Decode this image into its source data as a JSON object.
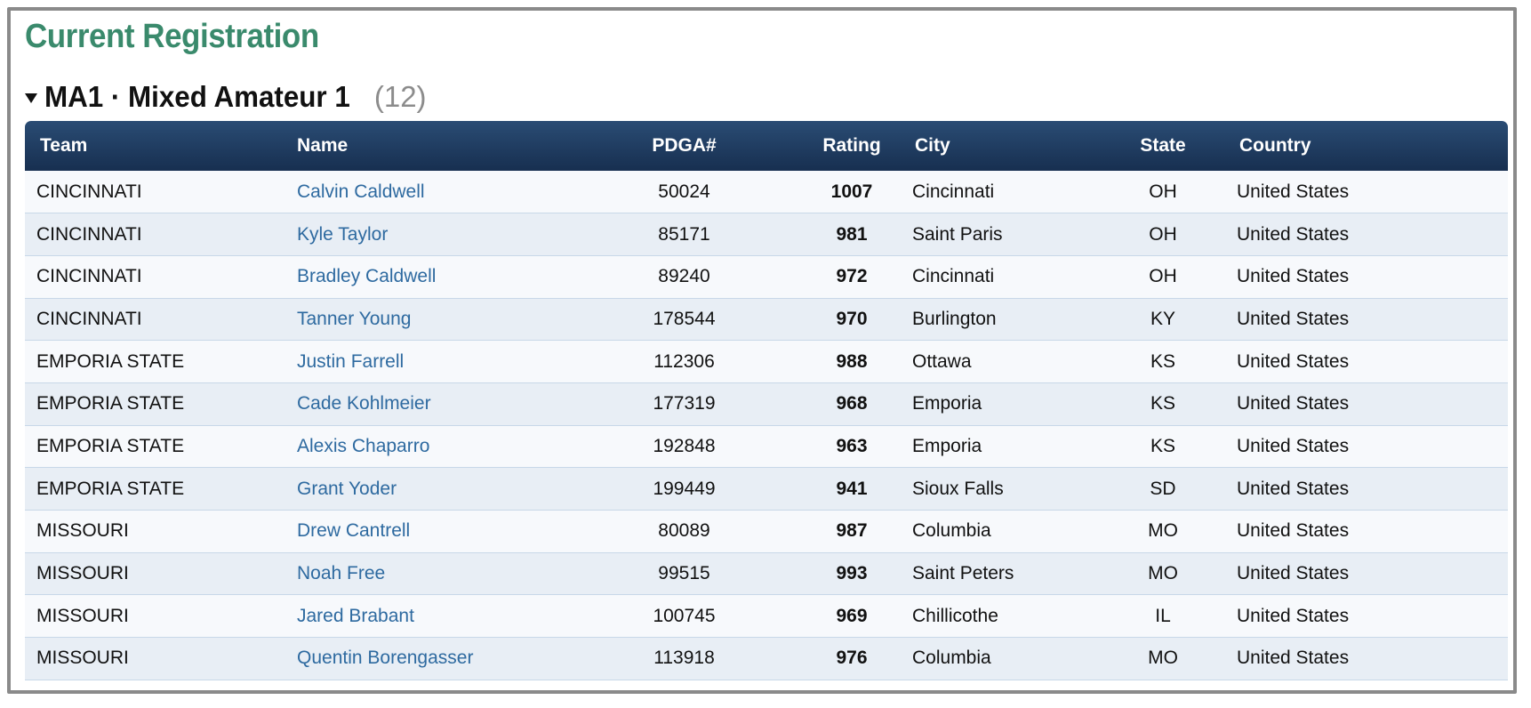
{
  "page_title": "Current Registration",
  "division": {
    "title": "MA1 · Mixed Amateur 1",
    "count": "(12)",
    "toggle_icon": "triangle-down-icon"
  },
  "table": {
    "headers": {
      "team": "Team",
      "name": "Name",
      "pdga": "PDGA#",
      "rating": "Rating",
      "city": "City",
      "state": "State",
      "country": "Country"
    },
    "rows": [
      {
        "team": "CINCINNATI",
        "name": "Calvin Caldwell",
        "pdga": "50024",
        "rating": "1007",
        "city": "Cincinnati",
        "state": "OH",
        "country": "United States"
      },
      {
        "team": "CINCINNATI",
        "name": "Kyle Taylor",
        "pdga": "85171",
        "rating": "981",
        "city": "Saint Paris",
        "state": "OH",
        "country": "United States"
      },
      {
        "team": "CINCINNATI",
        "name": "Bradley Caldwell",
        "pdga": "89240",
        "rating": "972",
        "city": "Cincinnati",
        "state": "OH",
        "country": "United States"
      },
      {
        "team": "CINCINNATI",
        "name": "Tanner Young",
        "pdga": "178544",
        "rating": "970",
        "city": "Burlington",
        "state": "KY",
        "country": "United States"
      },
      {
        "team": "EMPORIA STATE",
        "name": "Justin Farrell",
        "pdga": "112306",
        "rating": "988",
        "city": "Ottawa",
        "state": "KS",
        "country": "United States"
      },
      {
        "team": "EMPORIA STATE",
        "name": "Cade Kohlmeier",
        "pdga": "177319",
        "rating": "968",
        "city": "Emporia",
        "state": "KS",
        "country": "United States"
      },
      {
        "team": "EMPORIA STATE",
        "name": "Alexis Chaparro",
        "pdga": "192848",
        "rating": "963",
        "city": "Emporia",
        "state": "KS",
        "country": "United States"
      },
      {
        "team": "EMPORIA STATE",
        "name": "Grant Yoder",
        "pdga": "199449",
        "rating": "941",
        "city": "Sioux Falls",
        "state": "SD",
        "country": "United States"
      },
      {
        "team": "MISSOURI",
        "name": "Drew Cantrell",
        "pdga": "80089",
        "rating": "987",
        "city": "Columbia",
        "state": "MO",
        "country": "United States"
      },
      {
        "team": "MISSOURI",
        "name": "Noah Free",
        "pdga": "99515",
        "rating": "993",
        "city": "Saint Peters",
        "state": "MO",
        "country": "United States"
      },
      {
        "team": "MISSOURI",
        "name": "Jared Brabant",
        "pdga": "100745",
        "rating": "969",
        "city": "Chillicothe",
        "state": "IL",
        "country": "United States"
      },
      {
        "team": "MISSOURI",
        "name": "Quentin Borengasser",
        "pdga": "113918",
        "rating": "976",
        "city": "Columbia",
        "state": "MO",
        "country": "United States"
      }
    ]
  },
  "colors": {
    "title": "#3a8a6c",
    "header_bg": "#1f3d63",
    "link": "#2e6aa0",
    "count": "#8c8c8c"
  }
}
